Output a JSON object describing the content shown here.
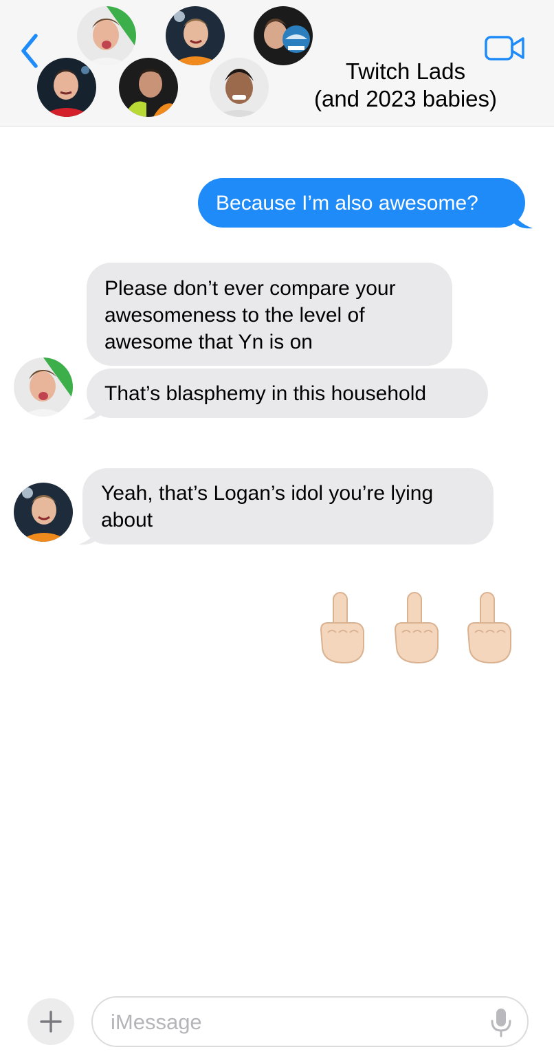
{
  "header": {
    "title_line1": "Twitch Lads",
    "title_line2": "(and 2023 babies)",
    "back_icon": "chevron-left-icon",
    "video_icon": "video-camera-icon",
    "accent_color": "#1e8bf9"
  },
  "messages": [
    {
      "direction": "outgoing",
      "text": "Because I’m also awesome?"
    },
    {
      "direction": "incoming",
      "lines": [
        "Please don’t ever compare your",
        "awesomeness to the level of",
        "awesome that Yn is on"
      ]
    },
    {
      "direction": "incoming",
      "text": "That’s blasphemy in this household"
    },
    {
      "direction": "incoming",
      "lines": [
        "Yeah, that’s Logan’s idol you’re lying",
        "about"
      ]
    },
    {
      "direction": "outgoing",
      "emoji": "🖕🏻🖕🏻🖕🏻"
    }
  ],
  "composer": {
    "placeholder": "iMessage",
    "value": "",
    "plus_icon": "plus-icon",
    "mic_icon": "microphone-icon"
  },
  "colors": {
    "outgoing_bubble": "#1e8bf9",
    "incoming_bubble": "#e9e9eb",
    "header_bg": "#f6f6f6"
  }
}
